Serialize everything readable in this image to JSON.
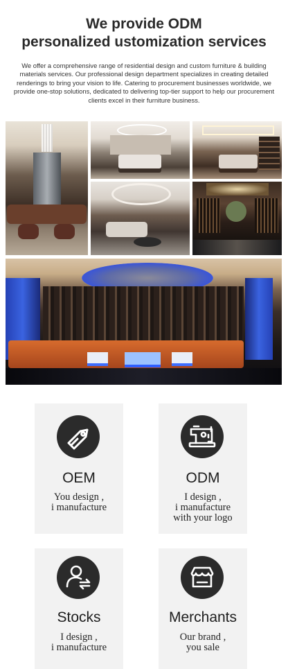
{
  "header": {
    "title_line1": "We provide ODM",
    "title_line2": "personalized ustomization services",
    "intro": "We offer a comprehensive range of residential design and custom furniture & building materials services. Our professional design department specializes in creating detailed renderings to bring your vision to life. Catering to procurement businesses worldwide, we provide one-stop solutions, dedicated to delivering top-tier support to help our procurement clients excel in their furniture business."
  },
  "gallery": {
    "photos": [
      {
        "subject": "living room"
      },
      {
        "subject": "bedroom"
      },
      {
        "subject": "bedroom"
      },
      {
        "subject": "lounge"
      },
      {
        "subject": "dining bar"
      },
      {
        "subject": "KTV room"
      }
    ]
  },
  "cards": [
    {
      "icon": "price-tag-icon",
      "title": "OEM",
      "sub_line1": "You design ,",
      "sub_line2": "i manufacture",
      "sub_line3": ""
    },
    {
      "icon": "sewing-machine-icon",
      "title": "ODM",
      "sub_line1": "I design ,",
      "sub_line2": "i manufacture",
      "sub_line3": "with your logo"
    },
    {
      "icon": "user-exchange-icon",
      "title": "Stocks",
      "sub_line1": "I design ,",
      "sub_line2": "i manufacture",
      "sub_line3": ""
    },
    {
      "icon": "storefront-icon",
      "title": "Merchants",
      "sub_line1": "Our brand ,",
      "sub_line2": "you sale",
      "sub_line3": ""
    }
  ],
  "colors": {
    "card_bg": "#f2f2f2",
    "icon_circle": "#2b2b2b",
    "title_text": "#2a2a2a"
  }
}
